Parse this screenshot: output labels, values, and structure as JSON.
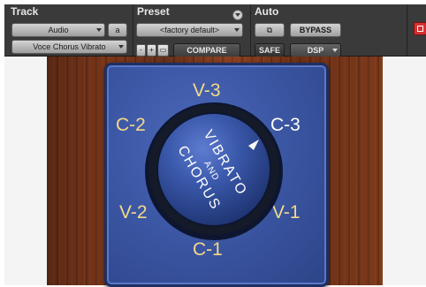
{
  "header": {
    "track": {
      "title": "Track",
      "track_type": "Audio",
      "track_letter": "a",
      "plugin_name": "Voce Chorus Vibrato"
    },
    "preset": {
      "title": "Preset",
      "current": "<factory default>",
      "minus": "-",
      "plus": "+",
      "compare": "COMPARE"
    },
    "auto": {
      "title": "Auto",
      "safe": "SAFE"
    },
    "bypass": "BYPASS",
    "dsp": "DSP"
  },
  "knob": {
    "positions": [
      "V-3",
      "C-3",
      "V-1",
      "C-1",
      "V-2",
      "C-2"
    ],
    "active_position": "C-3",
    "knob_text": [
      "VIBRATO",
      "AND",
      "CHORUS"
    ]
  },
  "colors": {
    "active_label": "#ffffff",
    "inactive_label": "#f2d98a",
    "panel": "#3c57a4"
  }
}
